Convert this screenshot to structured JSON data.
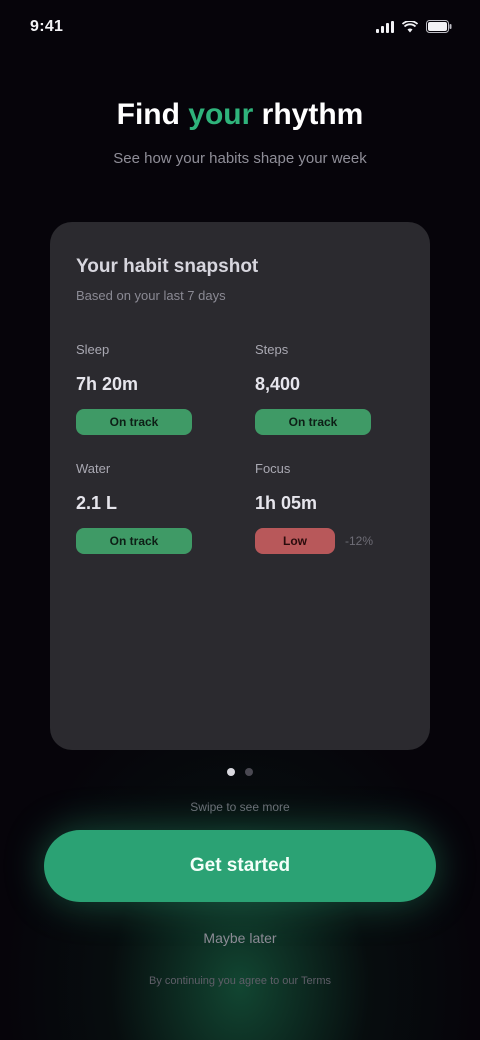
{
  "status_bar": {
    "time": "9:41"
  },
  "header": {
    "title_prefix": "Find",
    "title_accent": "your",
    "title_suffix": "rhythm",
    "subtitle": "See how your habits shape your week"
  },
  "card": {
    "title": "Your habit snapshot",
    "subtitle": "Based on your last 7 days",
    "stats": [
      {
        "label": "Sleep",
        "value": "7h 20m",
        "badge": "On track",
        "status": "good",
        "extra": ""
      },
      {
        "label": "Steps",
        "value": "8,400",
        "badge": "On track",
        "status": "good",
        "extra": ""
      },
      {
        "label": "Water",
        "value": "2.1 L",
        "badge": "On track",
        "status": "good",
        "extra": ""
      },
      {
        "label": "Focus",
        "value": "1h 05m",
        "badge": "Low",
        "status": "bad",
        "extra": "-12%"
      }
    ]
  },
  "pager": {
    "pages": 2,
    "active_index": 0,
    "note": "Swipe to see more"
  },
  "actions": {
    "cta_label": "Get started",
    "secondary_label": "Maybe later",
    "legal": "By continuing you agree to our Terms"
  },
  "colors": {
    "accent": "#2fb37b",
    "good": "#3f9a66",
    "bad": "#b8585a",
    "background": "#06040a",
    "card": "#2b2a2f"
  },
  "icons": [
    "signal-icon",
    "wifi-icon",
    "battery-icon"
  ]
}
